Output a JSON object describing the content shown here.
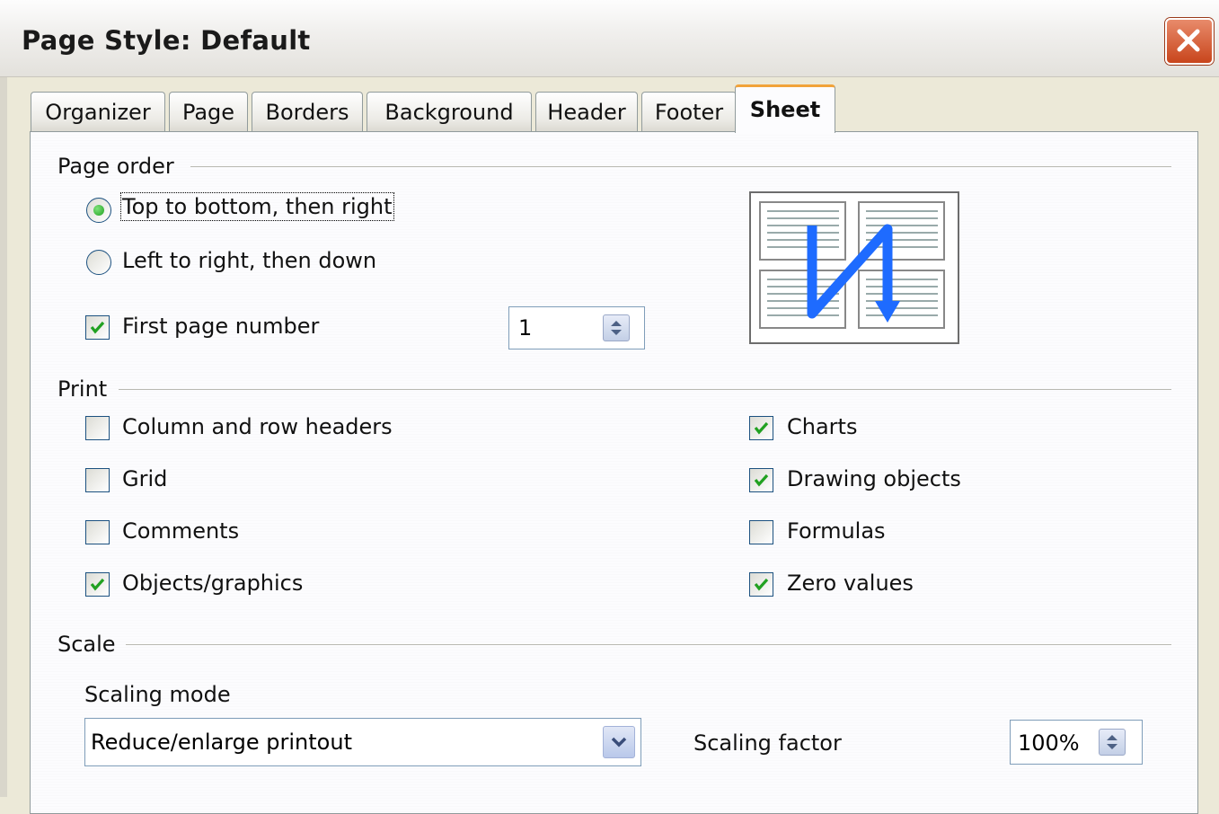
{
  "window": {
    "title": "Page Style: Default"
  },
  "tabs": [
    "Organizer",
    "Page",
    "Borders",
    "Background",
    "Header",
    "Footer",
    "Sheet"
  ],
  "active_tab": "Sheet",
  "page_order": {
    "legend": "Page order",
    "options": [
      {
        "label": "Top to bottom, then right",
        "selected": true
      },
      {
        "label": "Left to right, then down",
        "selected": false
      }
    ],
    "first_page_number": {
      "label": "First page number",
      "checked": true,
      "value": "1"
    }
  },
  "print": {
    "legend": "Print",
    "left": [
      {
        "label": "Column and row headers",
        "checked": false
      },
      {
        "label": "Grid",
        "checked": false
      },
      {
        "label": "Comments",
        "checked": false
      },
      {
        "label": "Objects/graphics",
        "checked": true
      }
    ],
    "right": [
      {
        "label": "Charts",
        "checked": true
      },
      {
        "label": "Drawing objects",
        "checked": true
      },
      {
        "label": "Formulas",
        "checked": false
      },
      {
        "label": "Zero values",
        "checked": true
      }
    ]
  },
  "scale": {
    "legend": "Scale",
    "mode_label": "Scaling mode",
    "mode_value": "Reduce/enlarge printout",
    "factor_label": "Scaling factor",
    "factor_value": "100%"
  },
  "icons": {
    "close": "close-icon",
    "spin": "spin-updown-icon",
    "dropdown": "chevron-down-icon",
    "preview": "page-order-preview-icon"
  },
  "colors": {
    "accent_tab": "#f1a33a",
    "check": "#21a121",
    "arrow": "#1e6bff"
  }
}
